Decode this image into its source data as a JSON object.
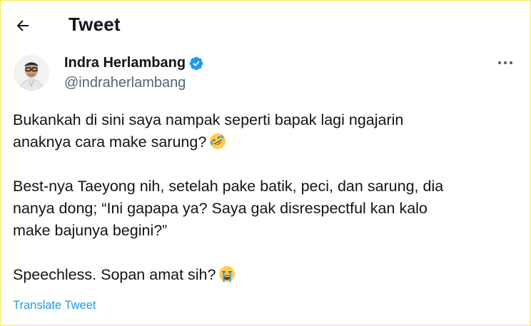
{
  "header": {
    "title": "Tweet",
    "back_icon": "arrow-left-icon"
  },
  "author": {
    "display_name": "Indra Herlambang",
    "handle": "@indraherlambang",
    "verified": true,
    "verified_icon": "verified-badge-icon",
    "more_icon": "more-horizontal-icon"
  },
  "tweet": {
    "paragraphs": [
      [
        "Bukankah di sini saya nampak seperti bapak lagi ngajarin",
        "anaknya cara make sarung?"
      ],
      [
        "Best-nya Taeyong nih, setelah pake batik, peci, dan sarung, dia",
        "nanya dong; “Ini gapapa ya? Saya gak disrespectful kan kalo",
        "make bajunya begini?”"
      ],
      [
        "Speechless. Sopan amat sih?"
      ]
    ],
    "emojis": [
      "rolling-on-floor-laughing-emoji",
      "loudly-crying-face-emoji"
    ],
    "translate_label": "Translate Tweet"
  },
  "colors": {
    "text": "#0f1419",
    "secondary": "#536471",
    "accent": "#1d9bf0",
    "frame_border": "#f2e94e"
  }
}
